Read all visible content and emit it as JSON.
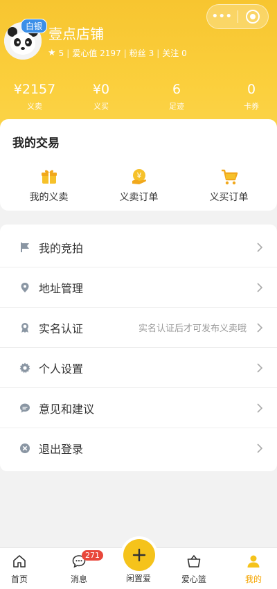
{
  "profile": {
    "shop_name": "壹点店铺",
    "level_badge": "白银",
    "rating": "5",
    "love_label": "爱心值 2197",
    "fans_label": "粉丝 3",
    "follow_label": "关注 0",
    "separator": "|"
  },
  "metrics": [
    {
      "value": "¥2157",
      "label": "义卖"
    },
    {
      "value": "¥0",
      "label": "义买"
    },
    {
      "value": "6",
      "label": "足迹"
    },
    {
      "value": "0",
      "label": "卡券"
    }
  ],
  "trade": {
    "title": "我的交易",
    "items": [
      {
        "label": "我的义卖",
        "icon": "gift-icon"
      },
      {
        "label": "义卖订单",
        "icon": "yen-bag-icon"
      },
      {
        "label": "义买订单",
        "icon": "cart-icon"
      }
    ]
  },
  "menu": [
    {
      "label": "我的竞拍",
      "icon": "flag-icon",
      "hint": ""
    },
    {
      "label": "地址管理",
      "icon": "location-pin-icon",
      "hint": ""
    },
    {
      "label": "实名认证",
      "icon": "certificate-icon",
      "hint": "实名认证后才可发布义卖哦"
    },
    {
      "label": "个人设置",
      "icon": "gear-icon",
      "hint": ""
    },
    {
      "label": "意见和建议",
      "icon": "chat-bubble-icon",
      "hint": ""
    },
    {
      "label": "退出登录",
      "icon": "close-circle-icon",
      "hint": ""
    }
  ],
  "tabs": [
    {
      "label": "首页",
      "icon": "home-icon"
    },
    {
      "label": "消息",
      "icon": "message-icon",
      "badge": "271"
    },
    {
      "label": "闲置爱",
      "icon": "plus-icon"
    },
    {
      "label": "爱心篮",
      "icon": "basket-icon"
    },
    {
      "label": "我的",
      "icon": "user-icon"
    }
  ],
  "colors": {
    "header": "#f7c530",
    "accent": "#f5c31b",
    "badge_blue": "#3b8fe8",
    "badge_red": "#e8473b"
  }
}
